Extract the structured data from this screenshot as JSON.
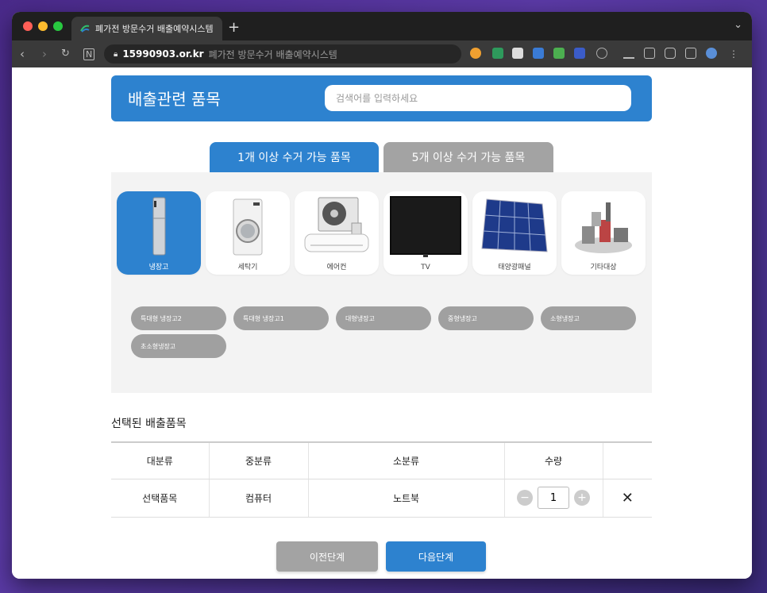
{
  "browser": {
    "tab_title": "폐가전 방문수거 배출예약시스템",
    "new_tab": "+",
    "url_domain": "15990903.or.kr",
    "url_page_title": "폐가전 방문수거 배출예약시스템"
  },
  "header": {
    "title": "배출관련 품목",
    "search_placeholder": "검색어를 입력하세요"
  },
  "tabs": [
    {
      "label": "1개 이상 수거 가능 품목",
      "active": true
    },
    {
      "label": "5개 이상 수거 가능 품목",
      "active": false
    }
  ],
  "categories": [
    {
      "label": "냉장고",
      "icon": "fridge-icon",
      "active": true
    },
    {
      "label": "세탁기",
      "icon": "washer-icon",
      "active": false
    },
    {
      "label": "에어컨",
      "icon": "aircon-icon",
      "active": false
    },
    {
      "label": "TV",
      "icon": "tv-icon",
      "active": false
    },
    {
      "label": "태양광패널",
      "icon": "solar-panel-icon",
      "active": false
    },
    {
      "label": "기타대상",
      "icon": "misc-appliance-icon",
      "active": false
    }
  ],
  "subcategories": [
    "특대형 냉장고2",
    "특대형 냉장고1",
    "대형냉장고",
    "중형냉장고",
    "소형냉장고",
    "초소형냉장고"
  ],
  "selected": {
    "title": "선택된 배출품목",
    "headers": [
      "대분류",
      "중분류",
      "소분류",
      "수량",
      ""
    ],
    "rows": [
      {
        "major": "선택품목",
        "middle": "컴퓨터",
        "minor": "노트북",
        "qty": "1",
        "delete": "✕"
      }
    ]
  },
  "buttons": {
    "prev": "이전단계",
    "next": "다음단계"
  },
  "colors": {
    "accent": "#2d82cf",
    "inactive": "#a0a0a0"
  }
}
